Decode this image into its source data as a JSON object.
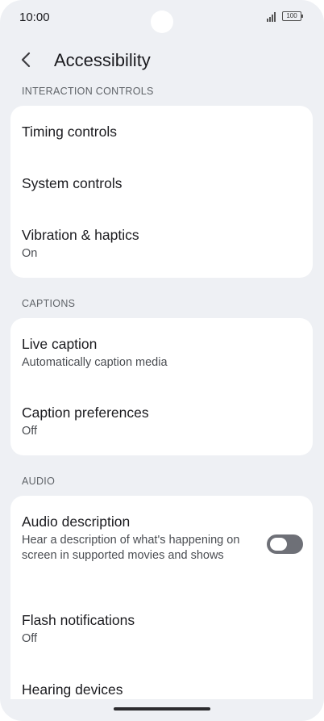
{
  "status_bar": {
    "time": "10:00",
    "battery": "100"
  },
  "header": {
    "title": "Accessibility"
  },
  "sections": [
    {
      "header": "INTERACTION CONTROLS",
      "items": [
        {
          "title": "Timing controls"
        },
        {
          "title": "System controls"
        },
        {
          "title": "Vibration & haptics",
          "subtitle": "On"
        }
      ]
    },
    {
      "header": "CAPTIONS",
      "items": [
        {
          "title": "Live caption",
          "subtitle": "Automatically caption media"
        },
        {
          "title": "Caption preferences",
          "subtitle": "Off"
        }
      ]
    },
    {
      "header": "AUDIO",
      "items": [
        {
          "title": "Audio description",
          "subtitle": "Hear a description of what's happening on screen in supported movies and shows",
          "toggle_on": false
        },
        {
          "title": "Flash notifications",
          "subtitle": "Off"
        },
        {
          "title": "Hearing devices"
        }
      ]
    }
  ]
}
